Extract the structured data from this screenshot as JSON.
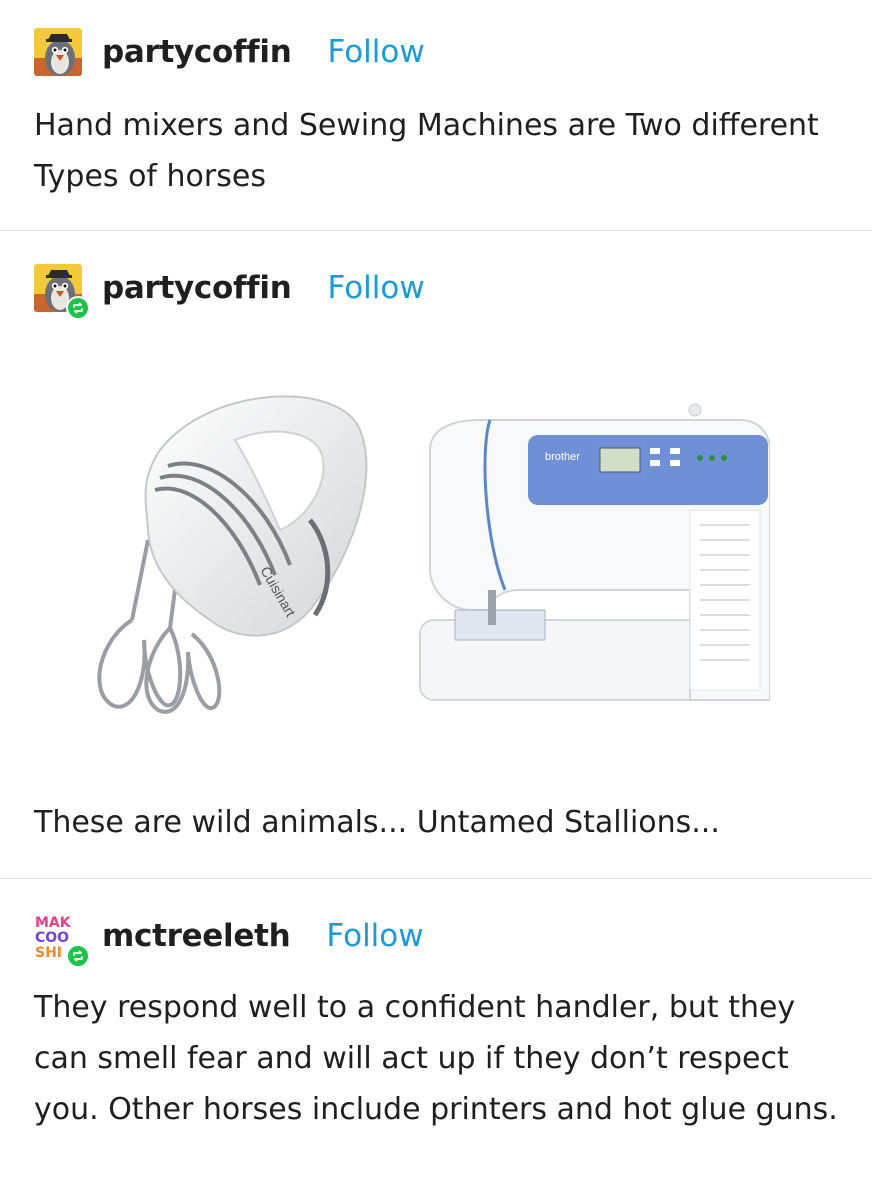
{
  "posts": [
    {
      "username": "partycoffin",
      "follow_label": "Follow",
      "avatar_icon": "penguin-avatar",
      "text": "Hand mixers and Sewing Machines are Two different Types of horses"
    },
    {
      "username": "partycoffin",
      "follow_label": "Follow",
      "avatar_icon": "penguin-avatar",
      "reblog_icon": "reblog-icon",
      "images": [
        "hand-mixer-image",
        "sewing-machine-image"
      ],
      "text": "These are wild animals... Untamed Stallions..."
    },
    {
      "username": "mctreeleth",
      "follow_label": "Follow",
      "avatar_icon": "make-cool-shit-avatar",
      "avatar_text": "MAKE COOL SHI",
      "reblog_icon": "reblog-icon",
      "text": "They respond well to a confident handler, but they can smell fear and will act up if they don’t respect you. Other horses include printers and hot glue guns."
    }
  ],
  "colors": {
    "follow": "#1a9bd8",
    "reblog_badge": "#1ec34a",
    "divider": "#e4e4e4"
  }
}
